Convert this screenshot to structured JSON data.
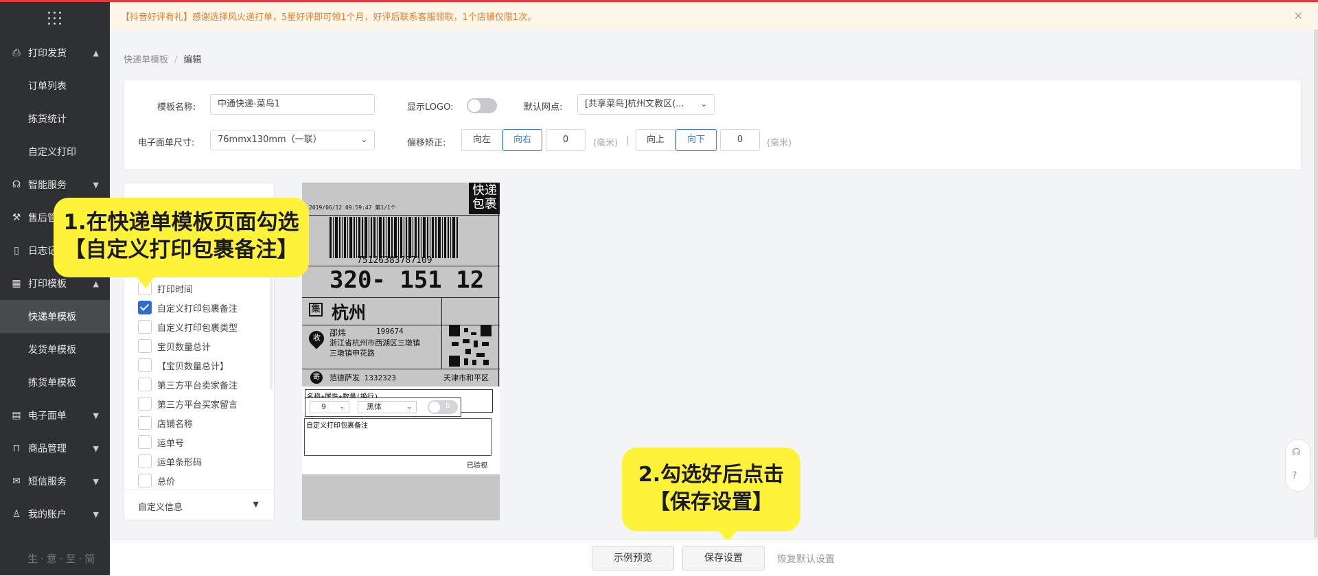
{
  "notice": {
    "text": "【抖音好评有礼】感谢选择风火递打单，5星好评即可领1个月，好评后联系客服领取，1个店铺仅限1次。",
    "close_icon": "×"
  },
  "sidebar": {
    "items": [
      {
        "label": "打印发货",
        "icon": "printer-icon",
        "expanded": true
      },
      {
        "label": "订单列表"
      },
      {
        "label": "拣货统计"
      },
      {
        "label": "自定义打印"
      },
      {
        "label": "智能服务",
        "icon": "headset-icon"
      },
      {
        "label": "售后管理",
        "icon": "wrench-icon"
      },
      {
        "label": "日志记录",
        "icon": "log-icon"
      },
      {
        "label": "打印模板",
        "icon": "template-icon",
        "expanded": true
      },
      {
        "label": "快递单模板",
        "active": true
      },
      {
        "label": "发货单模板"
      },
      {
        "label": "拣货单模板"
      },
      {
        "label": "电子面单",
        "icon": "waybill-icon"
      },
      {
        "label": "商品管理",
        "icon": "bag-icon"
      },
      {
        "label": "短信服务",
        "icon": "mail-icon"
      },
      {
        "label": "我的账户",
        "icon": "user-icon"
      }
    ],
    "logo": "生·意·至·简"
  },
  "breadcrumb": {
    "parent": "快递单模板",
    "separator": "/",
    "current": "编辑"
  },
  "form": {
    "template_name_label": "模板名称:",
    "template_name_value": "中通快递-菜鸟1",
    "show_logo_label": "显示LOGO:",
    "show_logo_on": false,
    "default_outlet_label": "默认网点:",
    "default_outlet_value": "[共享菜鸟]杭州文教区(...",
    "size_label": "电子面单尺寸:",
    "size_value": "76mmx130mm（一联）",
    "offset_label": "偏移矫正:",
    "left_btn": "向左",
    "right_btn": "向右",
    "h_offset": "0",
    "unit": "(毫米)",
    "divider": "|",
    "up_btn": "向上",
    "down_btn": "向下",
    "v_offset": "0"
  },
  "fields": {
    "items": [
      {
        "label": "打印时间",
        "checked": false
      },
      {
        "label": "自定义打印包裹备注",
        "checked": true
      },
      {
        "label": "自定义打印包裹类型",
        "checked": false
      },
      {
        "label": "宝贝数量总计",
        "checked": false
      },
      {
        "label": "【宝贝数量总计】",
        "checked": false
      },
      {
        "label": "第三方平台卖家备注",
        "checked": false
      },
      {
        "label": "第三方平台买家留言",
        "checked": false
      },
      {
        "label": "店铺名称",
        "checked": false
      },
      {
        "label": "运单号",
        "checked": false
      },
      {
        "label": "运单条形码",
        "checked": false
      },
      {
        "label": "总价",
        "checked": false
      }
    ],
    "footer": "自定义信息"
  },
  "preview": {
    "datetime": "2019/06/12   09:59:47   第1/1个",
    "badge": "快递包裹",
    "barcode_number": "75126383787109",
    "sort_code": "320- 151 12",
    "collect_mark": "集",
    "city": "杭州",
    "recv_mark": "收",
    "recv_name": "邵炜",
    "recv_phone": "199674",
    "recv_addr1": "浙江省杭州市西湖区三墩镇",
    "recv_addr2": "三墩镇申花路",
    "send_mark": "寄",
    "sender": "范德萨发 1332323",
    "sender_region": "天津市和平区",
    "goods_line": "名称+属性+数量(换行)",
    "font_size": "9",
    "font_family": "黑体",
    "bold_label": "B",
    "remark_box": "自定义打印包裹备注",
    "inspected": "已验视"
  },
  "callouts": {
    "step1_line1": "1.在快递单模板页面勾选",
    "step1_line2": "【自定义打印包裹备注】",
    "step2_line1": "2.勾选好后点击",
    "step2_line2": "【保存设置】"
  },
  "actions": {
    "preview": "示例预览",
    "save": "保存设置",
    "reset": "恢复默认设置"
  }
}
